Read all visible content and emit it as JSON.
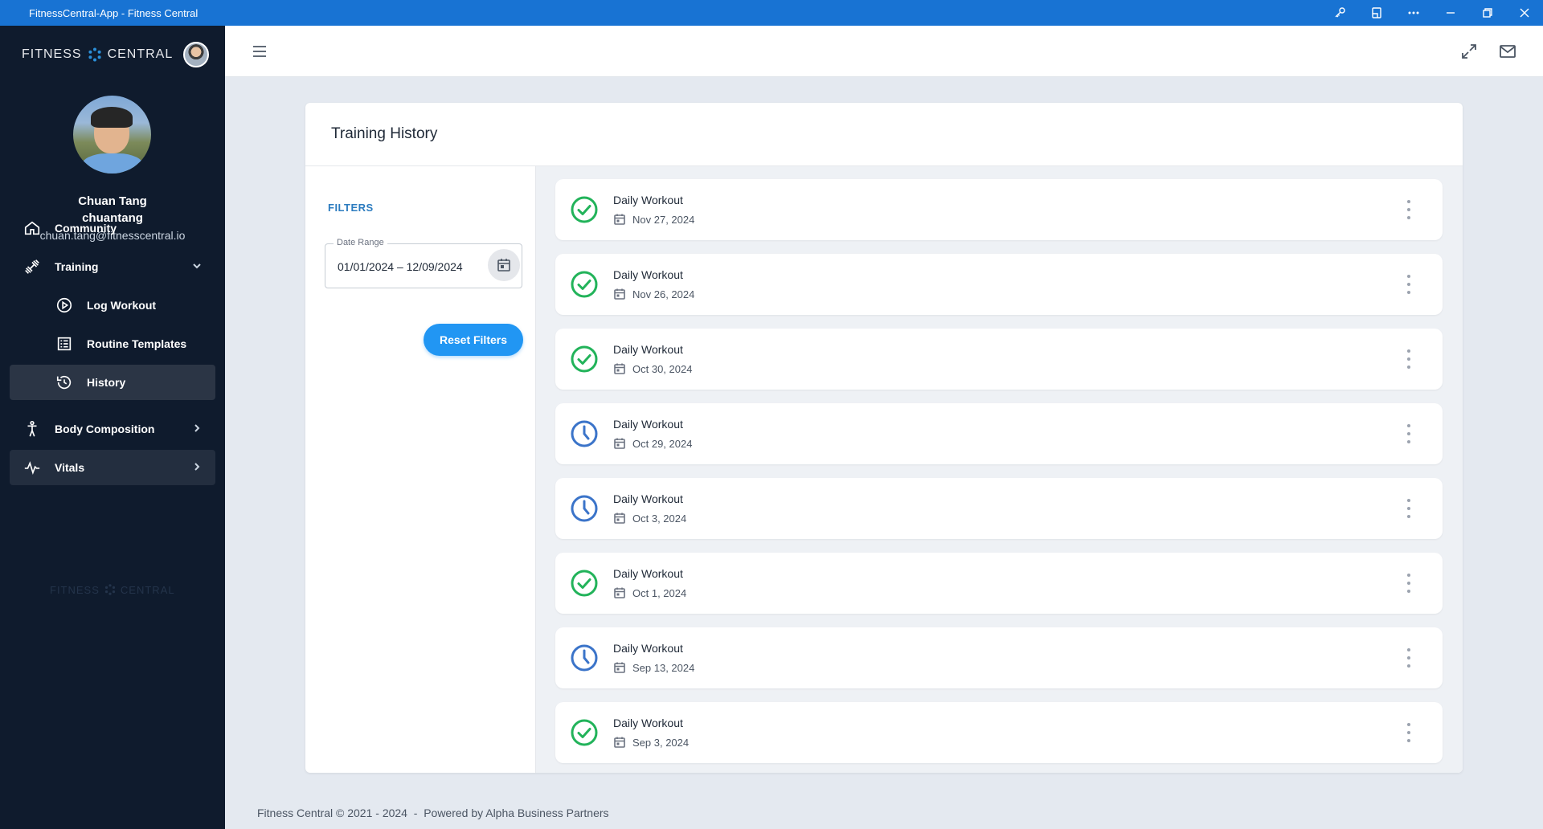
{
  "window": {
    "title": "FitnessCentral-App - Fitness Central"
  },
  "sidebar": {
    "brand_left": "FITNESS",
    "brand_right": "CENTRAL",
    "user": {
      "name": "Chuan Tang",
      "handle": "chuantang",
      "email": "chuan.tang@fitnesscentral.io"
    },
    "nav": {
      "community": "Community",
      "training": "Training",
      "log_workout": "Log Workout",
      "routine_templates": "Routine Templates",
      "history": "History",
      "body_composition": "Body Composition",
      "vitals": "Vitals"
    },
    "footer_brand_left": "FITNESS",
    "footer_brand_right": "CENTRAL"
  },
  "page": {
    "title": "Training History"
  },
  "filters": {
    "title": "FILTERS",
    "date_range_label": "Date Range",
    "date_range_value": "01/01/2024 – 12/09/2024",
    "reset_label": "Reset Filters"
  },
  "workouts": [
    {
      "title": "Daily Workout",
      "date": "Nov 27, 2024",
      "status": "completed"
    },
    {
      "title": "Daily Workout",
      "date": "Nov 26, 2024",
      "status": "completed"
    },
    {
      "title": "Daily Workout",
      "date": "Oct 30, 2024",
      "status": "completed"
    },
    {
      "title": "Daily Workout",
      "date": "Oct 29, 2024",
      "status": "pending"
    },
    {
      "title": "Daily Workout",
      "date": "Oct 3, 2024",
      "status": "pending"
    },
    {
      "title": "Daily Workout",
      "date": "Oct 1, 2024",
      "status": "completed"
    },
    {
      "title": "Daily Workout",
      "date": "Sep 13, 2024",
      "status": "pending"
    },
    {
      "title": "Daily Workout",
      "date": "Sep 3, 2024",
      "status": "completed"
    }
  ],
  "footer": {
    "text": "Fitness Central © 2021 - 2024  -  Powered by Alpha Business Partners"
  },
  "colors": {
    "titlebar": "#1873d3",
    "sidebar": "#0f1b2d",
    "accent": "#2196f3",
    "completed": "#22b35a",
    "pending": "#3b74c9"
  },
  "icons": {
    "completed": "check-circle-icon",
    "pending": "clock-icon"
  }
}
